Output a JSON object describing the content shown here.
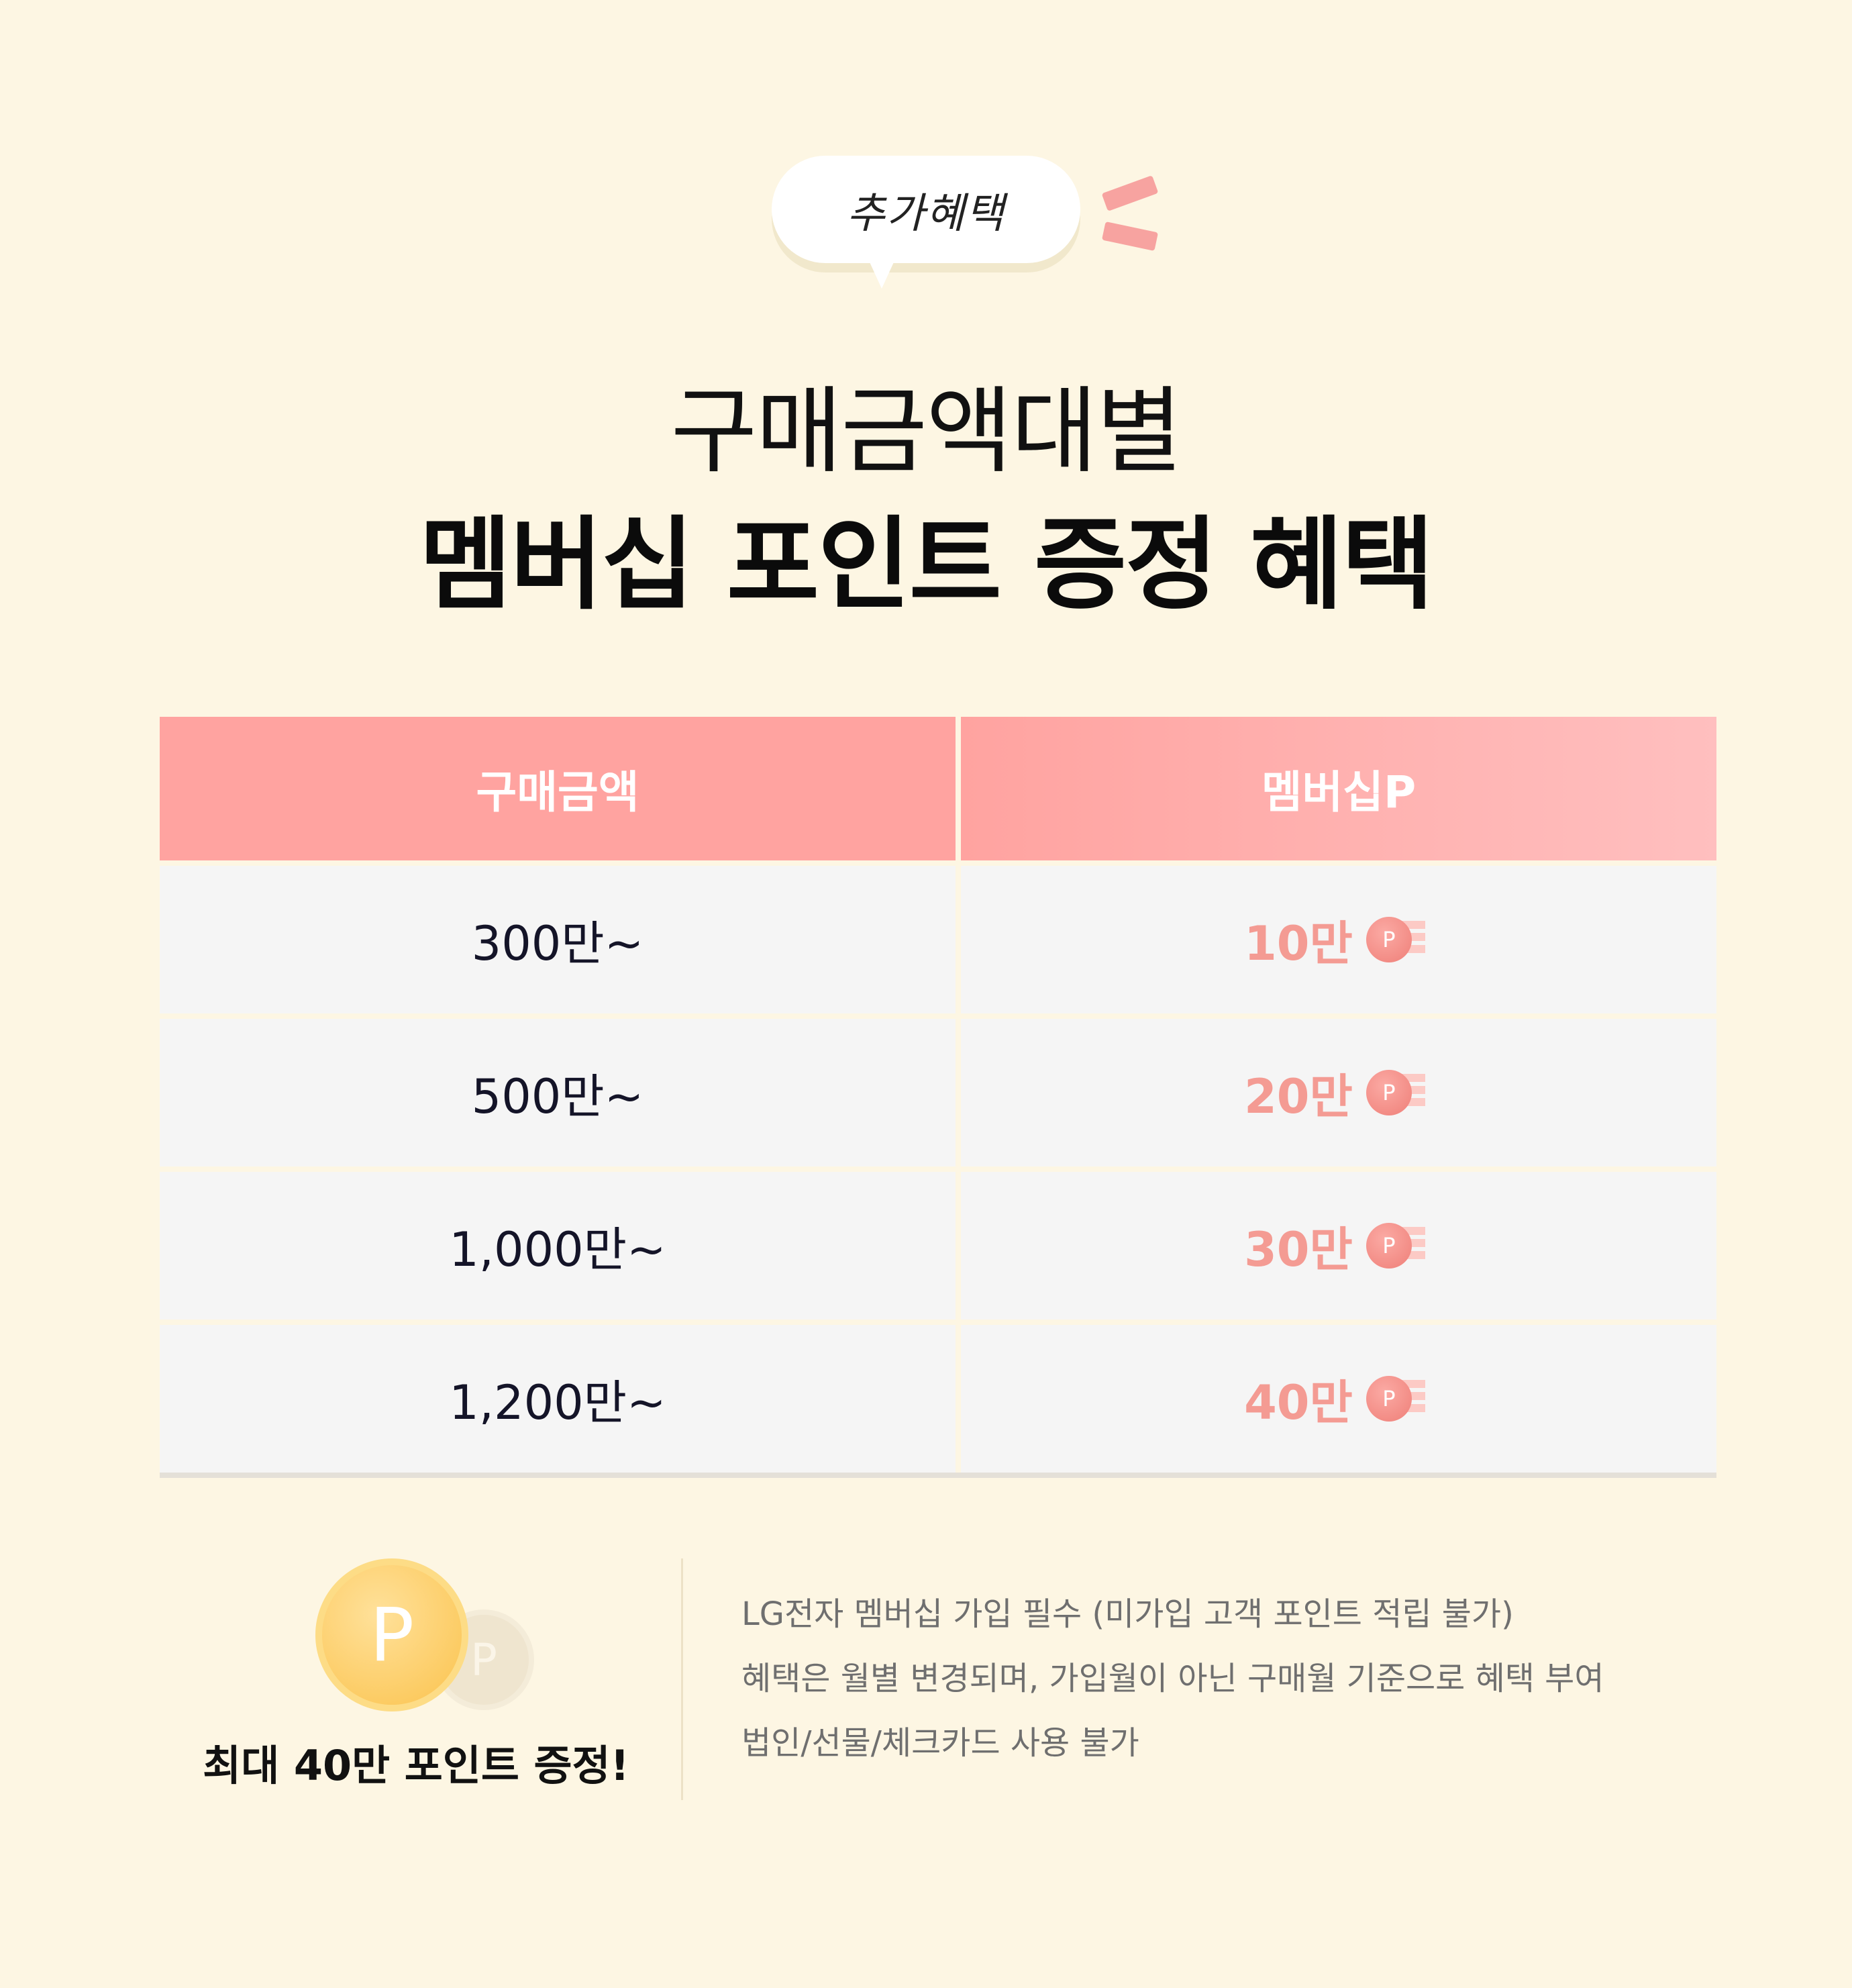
{
  "badge": {
    "text": "추가혜택"
  },
  "headline": {
    "line1": "구매금액대별",
    "line2": "멤버십 포인트 증정 혜택"
  },
  "table": {
    "headers": [
      "구매금액",
      "멤버십P"
    ],
    "rows": [
      {
        "amount": "300만~",
        "points": "10만"
      },
      {
        "amount": "500만~",
        "points": "20만"
      },
      {
        "amount": "1,000만~",
        "points": "30만"
      },
      {
        "amount": "1,200만~",
        "points": "40만"
      }
    ],
    "point_icon_letter": "P"
  },
  "footer": {
    "coin_letter": "P",
    "max_text": "최대 40만 포인트 증정!",
    "notes": [
      "LG전자 멤버십 가입 필수 (미가입 고객 포인트 적립 불가)",
      "혜택은 월별 변경되며, 가입월이 아닌 구매월 기준으로 혜택 부여",
      "법인/선물/체크카드 사용 불가"
    ]
  },
  "colors": {
    "background": "#fdf6e3",
    "header_pink": "#ffa3a0",
    "points_text": "#f49b93",
    "coin_gold": "#fbc34e"
  },
  "icons": [
    "speech-bubble",
    "point-coin-icon",
    "gold-coin-icon"
  ]
}
